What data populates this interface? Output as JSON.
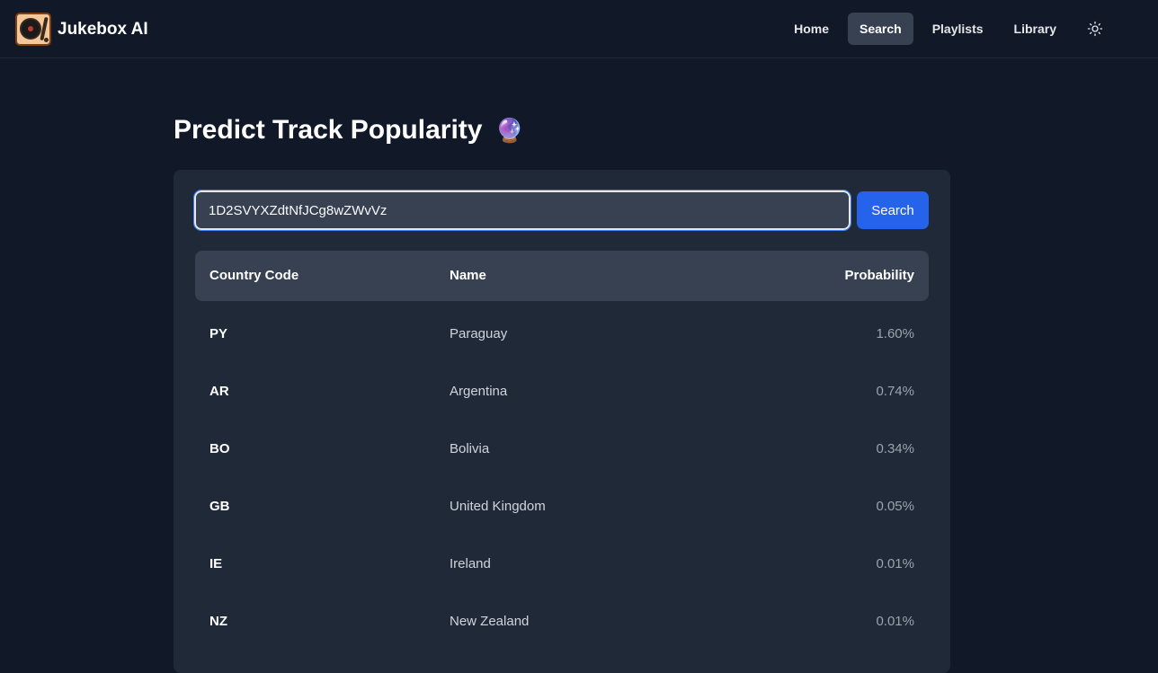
{
  "app": {
    "name": "Jukebox AI"
  },
  "nav": {
    "items": [
      {
        "label": "Home"
      },
      {
        "label": "Search"
      },
      {
        "label": "Playlists"
      },
      {
        "label": "Library"
      }
    ],
    "active": "Search",
    "theme_icon": "sun-icon"
  },
  "page": {
    "title": "Predict Track Popularity",
    "title_emoji": "🔮"
  },
  "search": {
    "value": "1D2SVYXZdtNfJCg8wZWvVz",
    "button_label": "Search"
  },
  "table": {
    "headers": {
      "code": "Country Code",
      "name": "Name",
      "probability": "Probability"
    },
    "rows": [
      {
        "code": "PY",
        "name": "Paraguay",
        "probability": "1.60%"
      },
      {
        "code": "AR",
        "name": "Argentina",
        "probability": "0.74%"
      },
      {
        "code": "BO",
        "name": "Bolivia",
        "probability": "0.34%"
      },
      {
        "code": "GB",
        "name": "United Kingdom",
        "probability": "0.05%"
      },
      {
        "code": "IE",
        "name": "Ireland",
        "probability": "0.01%"
      },
      {
        "code": "NZ",
        "name": "New Zealand",
        "probability": "0.01%"
      }
    ]
  },
  "colors": {
    "background": "#111827",
    "card": "#1f2937",
    "accent": "#2563eb"
  }
}
